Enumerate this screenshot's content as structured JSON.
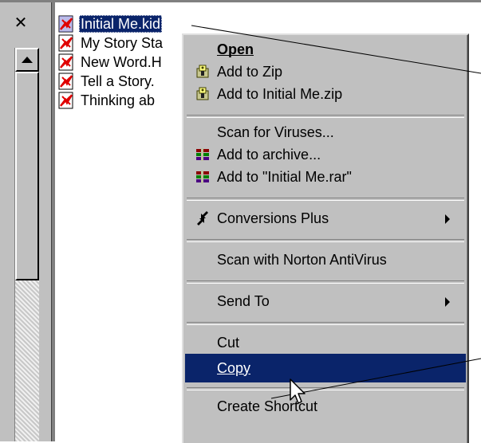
{
  "pane": {
    "close_glyph": "✕"
  },
  "files": [
    {
      "name": "Initial Me.kid",
      "selected": true
    },
    {
      "name": "My Story Sta",
      "selected": false
    },
    {
      "name": "New Word.H",
      "selected": false
    },
    {
      "name": "Tell a Story.",
      "selected": false
    },
    {
      "name": "Thinking ab",
      "selected": false
    }
  ],
  "menu": {
    "open": {
      "label": "Open",
      "access_key": "O"
    },
    "add_to_zip": {
      "label": "Add to Zip",
      "access_key": "Z"
    },
    "add_to_named_zip": {
      "label": "Add to Initial Me.zip",
      "access_key": "A"
    },
    "scan_viruses": {
      "label": "Scan for Viruses..."
    },
    "add_to_archive": {
      "label": "Add to archive..."
    },
    "add_to_named_rar": {
      "label": "Add to \"Initial Me.rar\""
    },
    "conversions_plus": {
      "label": "Conversions Plus",
      "access_key": "C"
    },
    "norton": {
      "label": "Scan with Norton AntiVirus",
      "access_key": "V"
    },
    "send_to": {
      "label": "Send To",
      "access_key": "T"
    },
    "cut": {
      "label": "Cut",
      "access_key": "t"
    },
    "copy": {
      "label": "Copy",
      "access_key": "C"
    },
    "create_shortcut": {
      "label": "Create Shortcut"
    }
  },
  "colors": {
    "selection": "#0a246a",
    "menu_face": "#c0c0c0",
    "winrar_icon": [
      "#8b0000",
      "#008000",
      "#4b0082"
    ]
  },
  "icons": {
    "file": "kidpix-document-icon",
    "zip": "winzip-icon",
    "rar": "winrar-icon",
    "conversions": "conversions-arrow-icon",
    "cursor": "mouse-pointer-icon"
  }
}
